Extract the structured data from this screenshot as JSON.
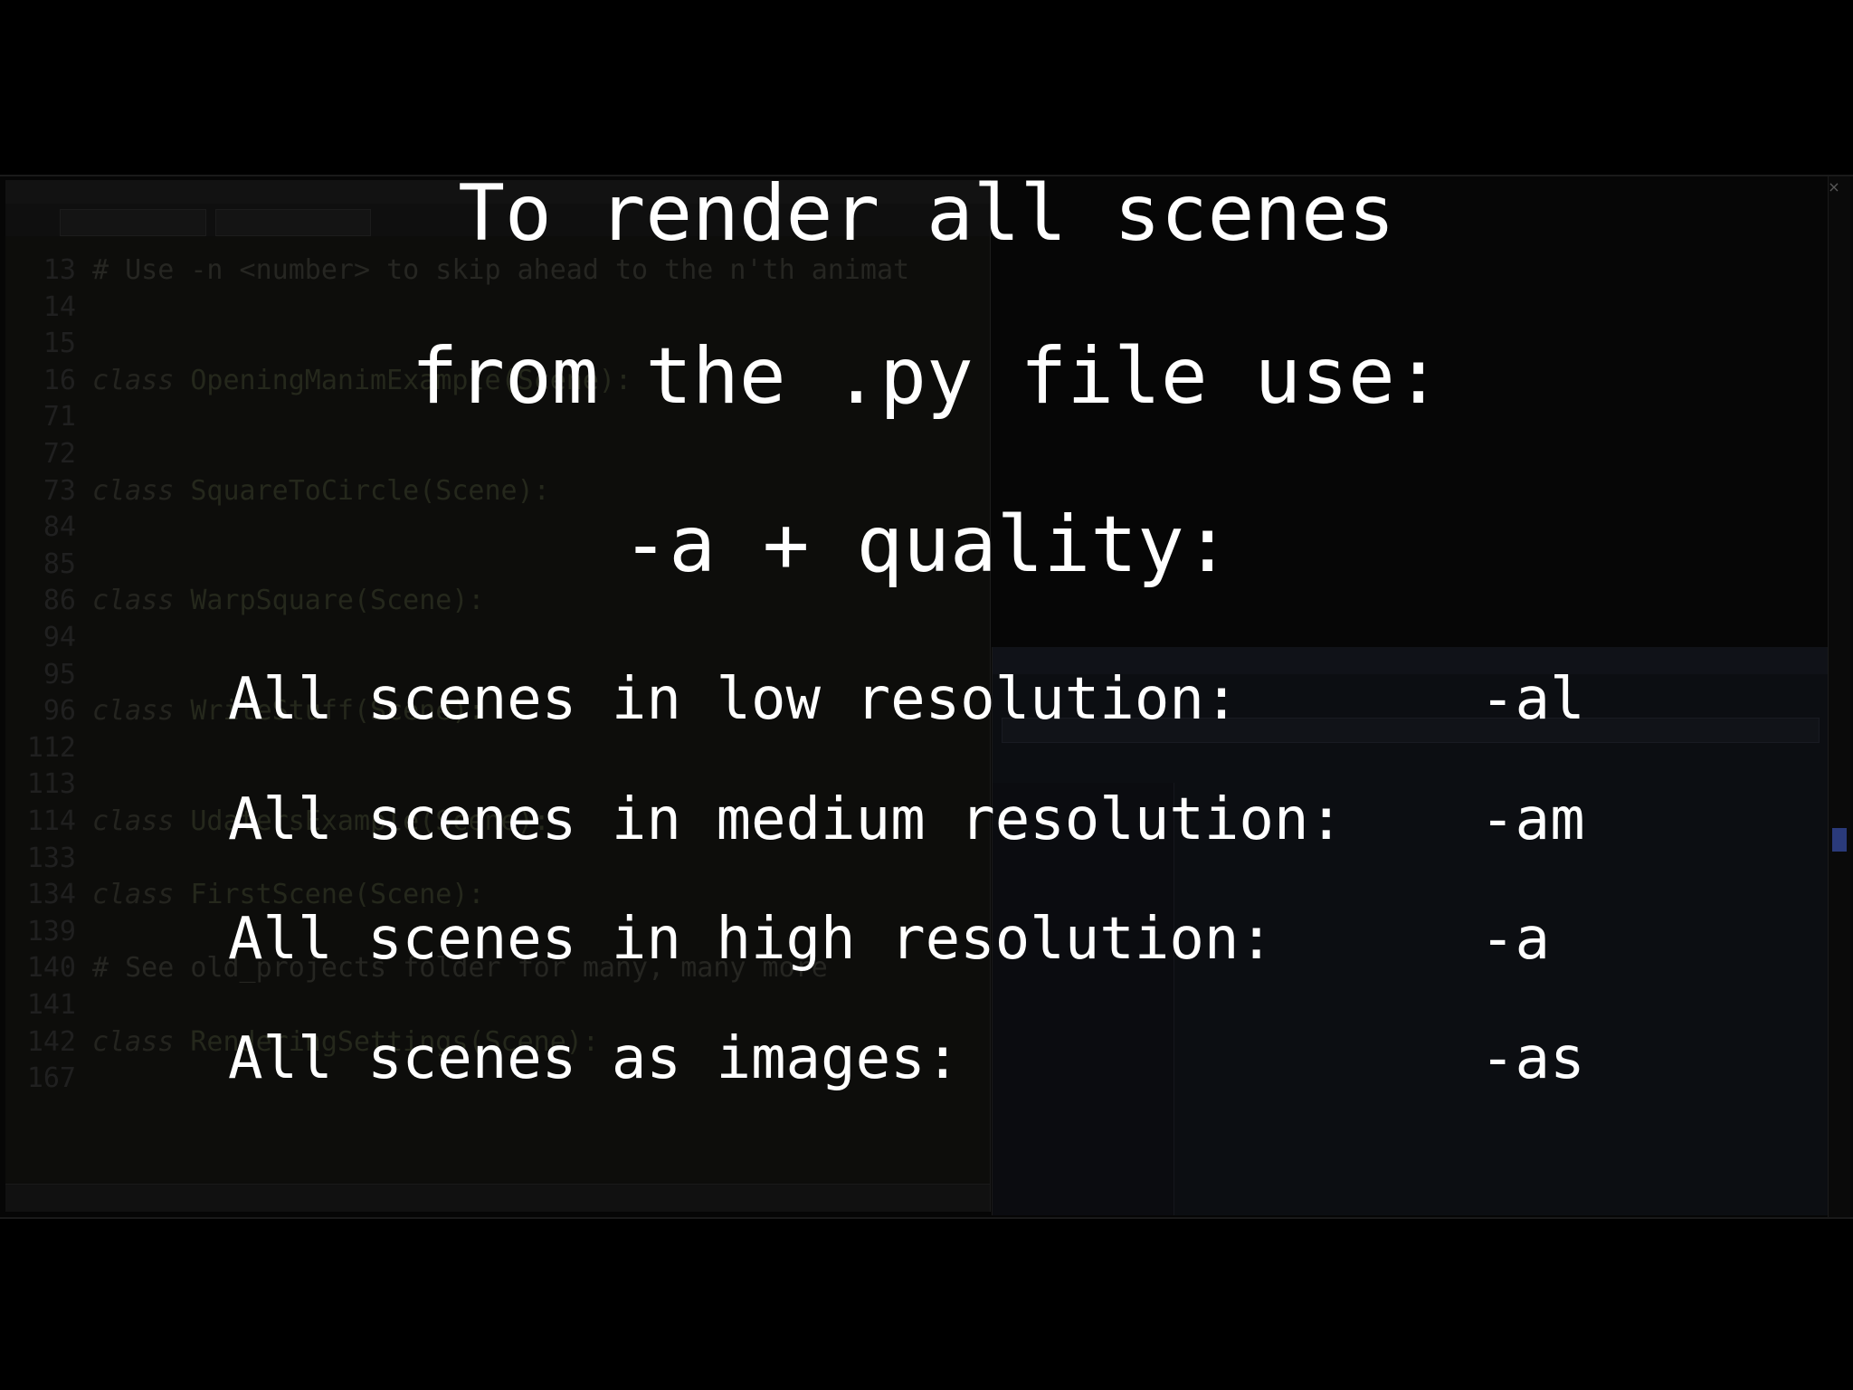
{
  "overlay": {
    "heading_lines": [
      "To render all scenes",
      "from the .py file use:",
      "-a + quality:"
    ],
    "options": [
      {
        "label": "All scenes in low resolution:",
        "flag": "-al"
      },
      {
        "label": "All scenes in medium resolution:",
        "flag": "-am"
      },
      {
        "label": "All scenes in high resolution:",
        "flag": "-a"
      },
      {
        "label": "All scenes as images:",
        "flag": "-as"
      }
    ]
  },
  "editor": {
    "code_lines": [
      {
        "num": "13",
        "text": "# Use -n <number> to skip ahead to the n'th animat"
      },
      {
        "num": "14",
        "text": ""
      },
      {
        "num": "15",
        "text": ""
      },
      {
        "num": "16",
        "kw": "class",
        "text": " OpeningManimExample(Scene):"
      },
      {
        "num": "71",
        "text": ""
      },
      {
        "num": "72",
        "text": ""
      },
      {
        "num": "73",
        "kw": "class",
        "text": " SquareToCircle(Scene):"
      },
      {
        "num": "84",
        "text": ""
      },
      {
        "num": "85",
        "text": ""
      },
      {
        "num": "86",
        "kw": "class",
        "text": " WarpSquare(Scene):"
      },
      {
        "num": "94",
        "text": ""
      },
      {
        "num": "95",
        "text": ""
      },
      {
        "num": "96",
        "kw": "class",
        "text": " WriteStuff(Scene):"
      },
      {
        "num": "112",
        "text": ""
      },
      {
        "num": "113",
        "text": ""
      },
      {
        "num": "114",
        "kw": "class",
        "text": " UdatersExample(Scene):"
      },
      {
        "num": "133",
        "text": ""
      },
      {
        "num": "134",
        "kw": "class",
        "text": " FirstScene(Scene):"
      },
      {
        "num": "139",
        "text": ""
      },
      {
        "num": "140",
        "text": "# See old_projects folder for many, many more"
      },
      {
        "num": "141",
        "text": ""
      },
      {
        "num": "142",
        "kw": "class",
        "text": " RenderingSettings(Scene):"
      },
      {
        "num": "167",
        "text": ""
      }
    ]
  },
  "window": {
    "close_glyph": "×"
  },
  "colors": {
    "background": "#000000",
    "caption_text": "#ffffff",
    "dim_code": "#262622"
  }
}
